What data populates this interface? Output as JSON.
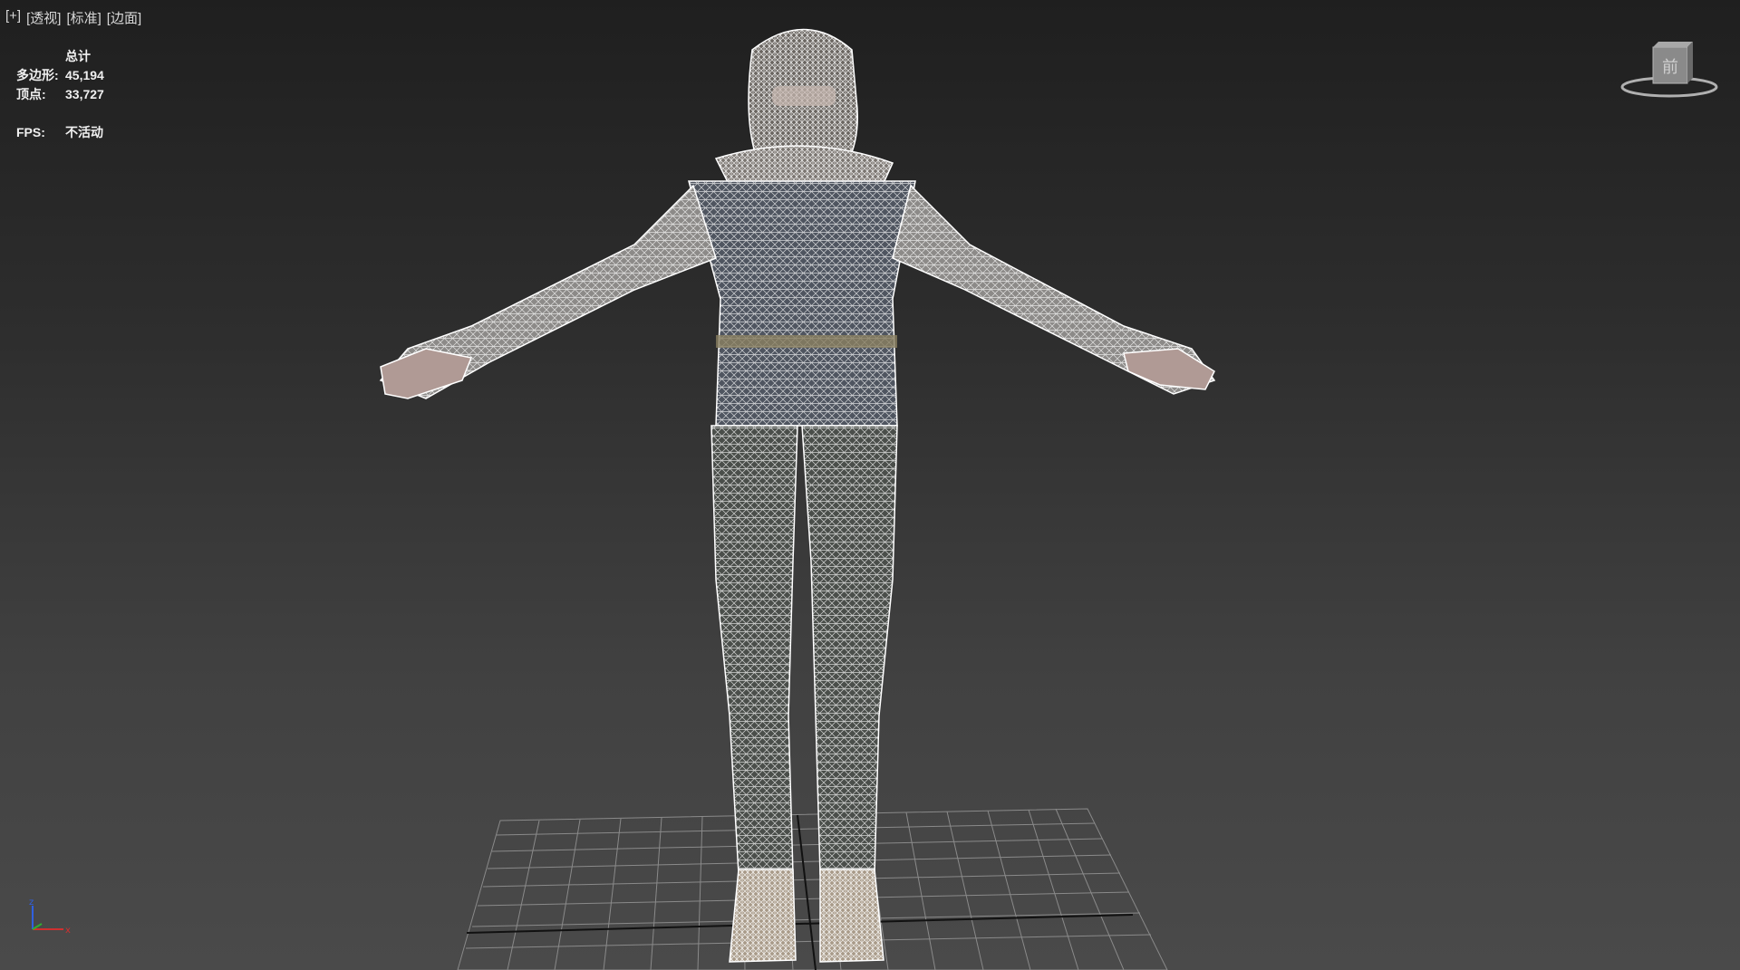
{
  "viewport": {
    "labels": [
      "[+]",
      "[透视]",
      "[标准]",
      "[边面]"
    ]
  },
  "stats": {
    "header": "总计",
    "polygons_label": "多边形:",
    "polygons_value": "45,194",
    "vertices_label": "顶点:",
    "vertices_value": "33,727",
    "fps_label": "FPS:",
    "fps_value": "不活动"
  },
  "viewcube": {
    "face_label": "前",
    "icon": "viewcube-icon"
  },
  "axis_gizmo": {
    "x": "x",
    "z": "z"
  },
  "colors": {
    "background_top": "#1f1f1f",
    "background_bottom": "#4a4a4a",
    "wireframe": "#ffffff",
    "grid": "#8a8a8a",
    "axis_x": "#d03030",
    "axis_y": "#30b030",
    "axis_z": "#3060e0"
  }
}
